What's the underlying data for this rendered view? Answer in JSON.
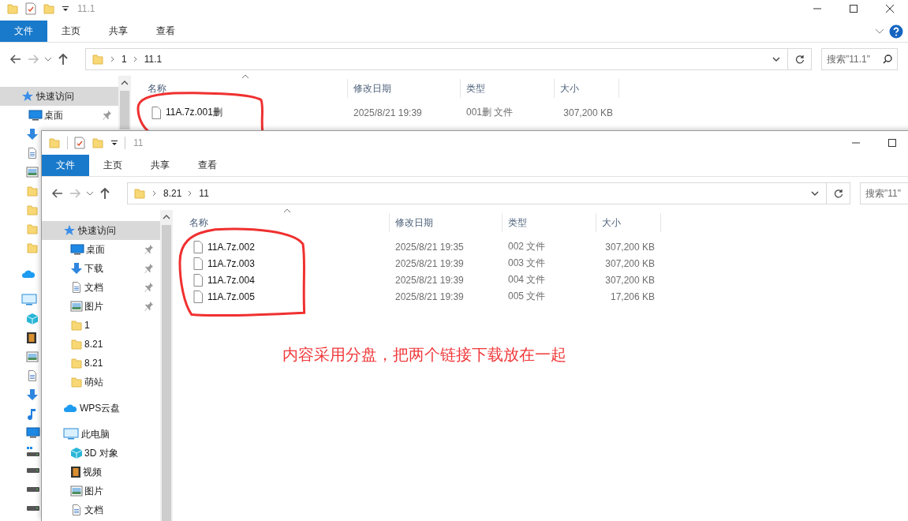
{
  "windows": [
    {
      "title": "11.1",
      "ribbon_tabs": [
        {
          "label": "文件",
          "selected": true
        },
        {
          "label": "主页",
          "selected": false
        },
        {
          "label": "共享",
          "selected": false
        },
        {
          "label": "查看",
          "selected": false
        }
      ],
      "path": [
        "1",
        "11.1"
      ],
      "search": {
        "placeholder": "搜索\"11.1\""
      },
      "sidebar": [
        {
          "label": "快速访问",
          "kind": "star",
          "selected": true,
          "children": [
            {
              "label": "桌面",
              "kind": "desktop",
              "pinned": true,
              "selected": false
            },
            {
              "kind": "download",
              "selected": false
            },
            {
              "kind": "doc",
              "selected": false
            },
            {
              "kind": "picture",
              "selected": false
            },
            {
              "kind": "folder",
              "selected": false
            },
            {
              "kind": "folder",
              "selected": false
            },
            {
              "kind": "folder",
              "selected": false
            },
            {
              "kind": "folder",
              "selected": false
            }
          ]
        },
        {
          "kind": "cloud",
          "selected": false
        },
        {
          "kind": "pc",
          "selected": false,
          "children": [
            {
              "kind": "cube",
              "selected": false
            },
            {
              "kind": "video",
              "selected": false
            },
            {
              "kind": "picture",
              "selected": false
            },
            {
              "kind": "doc",
              "selected": false
            },
            {
              "kind": "download",
              "selected": false
            },
            {
              "kind": "music",
              "selected": false
            },
            {
              "kind": "desktop",
              "selected": false
            },
            {
              "kind": "netdrive",
              "selected": false
            },
            {
              "kind": "drive",
              "selected": false
            },
            {
              "kind": "drive",
              "selected": false
            },
            {
              "kind": "drive",
              "selected": false
            }
          ]
        }
      ],
      "columns": [
        "名称",
        "修改日期",
        "类型",
        "大小"
      ],
      "files": [
        {
          "name": "11A.7z.001删",
          "modified": "2025/8/21 19:39",
          "type": "001删 文件",
          "size": "307,200 KB"
        }
      ]
    },
    {
      "title": "11",
      "ribbon_tabs": [
        {
          "label": "文件",
          "selected": true
        },
        {
          "label": "主页",
          "selected": false
        },
        {
          "label": "共享",
          "selected": false
        },
        {
          "label": "查看",
          "selected": false
        }
      ],
      "path": [
        "8.21",
        "11"
      ],
      "search": {
        "placeholder": "搜索\"11\""
      },
      "sidebar": [
        {
          "label": "快速访问",
          "kind": "star",
          "selected": true,
          "children": [
            {
              "label": "桌面",
              "kind": "desktop",
              "pinned": true,
              "selected": false
            },
            {
              "label": "下载",
              "kind": "download",
              "pinned": true,
              "selected": false
            },
            {
              "label": "文档",
              "kind": "doc",
              "pinned": true,
              "selected": false
            },
            {
              "label": "图片",
              "kind": "picture",
              "pinned": true,
              "selected": false
            },
            {
              "label": "1",
              "kind": "folder",
              "pinned": false,
              "selected": false
            },
            {
              "label": "8.21",
              "kind": "folder",
              "pinned": false,
              "selected": false
            },
            {
              "label": "8.21",
              "kind": "folder",
              "pinned": false,
              "selected": false
            },
            {
              "label": "萌站",
              "kind": "folder",
              "pinned": false,
              "selected": false
            }
          ]
        },
        {
          "label": "WPS云盘",
          "kind": "cloud",
          "selected": false
        },
        {
          "label": "此电脑",
          "kind": "pc",
          "selected": false,
          "children": [
            {
              "label": "3D 对象",
              "kind": "cube",
              "selected": false
            },
            {
              "label": "视频",
              "kind": "video",
              "selected": false
            },
            {
              "label": "图片",
              "kind": "picture",
              "selected": false
            },
            {
              "label": "文档",
              "kind": "doc",
              "selected": false
            }
          ]
        }
      ],
      "columns": [
        "名称",
        "修改日期",
        "类型",
        "大小"
      ],
      "files": [
        {
          "name": "11A.7z.002",
          "modified": "2025/8/21 19:35",
          "type": "002 文件",
          "size": "307,200 KB"
        },
        {
          "name": "11A.7z.003",
          "modified": "2025/8/21 19:39",
          "type": "003 文件",
          "size": "307,200 KB"
        },
        {
          "name": "11A.7z.004",
          "modified": "2025/8/21 19:39",
          "type": "004 文件",
          "size": "307,200 KB"
        },
        {
          "name": "11A.7z.005",
          "modified": "2025/8/21 19:39",
          "type": "005 文件",
          "size": "17,206 KB"
        }
      ],
      "annotation": "内容采用分盘，把两个链接下载放在一起"
    }
  ]
}
